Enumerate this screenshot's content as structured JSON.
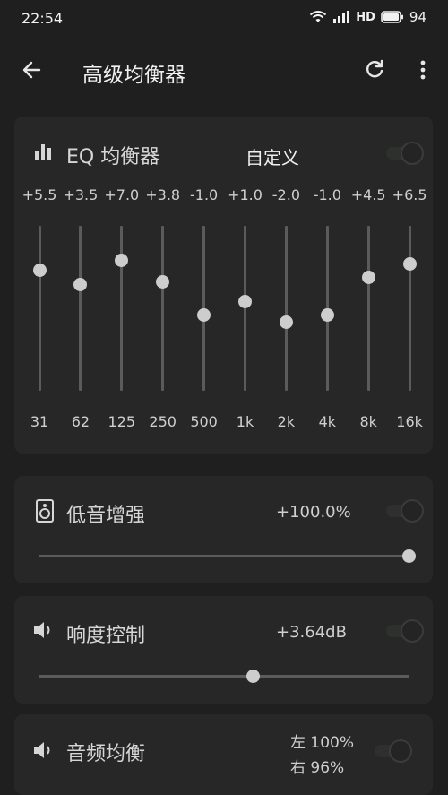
{
  "status_bar": {
    "time": "22:54",
    "network_label": "HD",
    "battery": "94"
  },
  "app_bar": {
    "title": "高级均衡器",
    "back_icon": "arrow-back-icon",
    "refresh_icon": "refresh-icon",
    "more_icon": "more-vert-icon"
  },
  "eq": {
    "title": "EQ 均衡器",
    "preset": "自定义",
    "enabled": false,
    "gain_range_db": [
      -12,
      12
    ],
    "bands": [
      {
        "freq": "31",
        "gain_label": "+5.5",
        "gain": 5.5
      },
      {
        "freq": "62",
        "gain_label": "+3.5",
        "gain": 3.5
      },
      {
        "freq": "125",
        "gain_label": "+7.0",
        "gain": 7.0
      },
      {
        "freq": "250",
        "gain_label": "+3.8",
        "gain": 3.8
      },
      {
        "freq": "500",
        "gain_label": "-1.0",
        "gain": -1.0
      },
      {
        "freq": "1k",
        "gain_label": "+1.0",
        "gain": 1.0
      },
      {
        "freq": "2k",
        "gain_label": "-2.0",
        "gain": -2.0
      },
      {
        "freq": "4k",
        "gain_label": "-1.0",
        "gain": -1.0
      },
      {
        "freq": "8k",
        "gain_label": "+4.5",
        "gain": 4.5
      },
      {
        "freq": "16k",
        "gain_label": "+6.5",
        "gain": 6.5
      }
    ]
  },
  "bass": {
    "title": "低音增强",
    "value": "+100.0%",
    "level": 1.0,
    "enabled": false
  },
  "loudness": {
    "title": "响度控制",
    "value": "+3.64dB",
    "level": 0.58,
    "enabled": false
  },
  "balance": {
    "title": "音频均衡",
    "left": "左 100%",
    "right": "右 96%",
    "enabled": false
  },
  "colors": {
    "background": "#1e1f1e",
    "card": "#262726",
    "knob": "#cdcdcd",
    "track": "#5a5b5a"
  }
}
